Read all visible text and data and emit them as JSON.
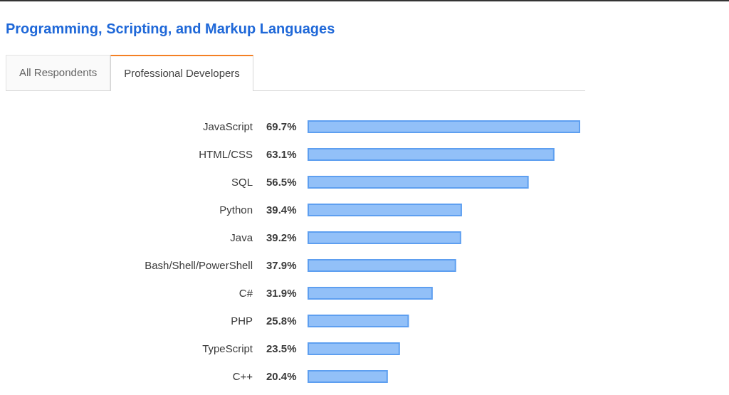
{
  "title": "Programming, Scripting, and Markup Languages",
  "tabs": [
    {
      "label": "All Respondents",
      "selected": false
    },
    {
      "label": "Professional Developers",
      "selected": true
    }
  ],
  "chart_data": {
    "type": "bar",
    "orientation": "horizontal",
    "categories": [
      "JavaScript",
      "HTML/CSS",
      "SQL",
      "Python",
      "Java",
      "Bash/Shell/PowerShell",
      "C#",
      "PHP",
      "TypeScript",
      "C++"
    ],
    "values": [
      69.7,
      63.1,
      56.5,
      39.4,
      39.2,
      37.9,
      31.9,
      25.8,
      23.5,
      20.4
    ],
    "value_labels": [
      "69.7%",
      "63.1%",
      "56.5%",
      "39.4%",
      "39.2%",
      "37.9%",
      "31.9%",
      "25.8%",
      "23.5%",
      "20.4%"
    ]
  }
}
